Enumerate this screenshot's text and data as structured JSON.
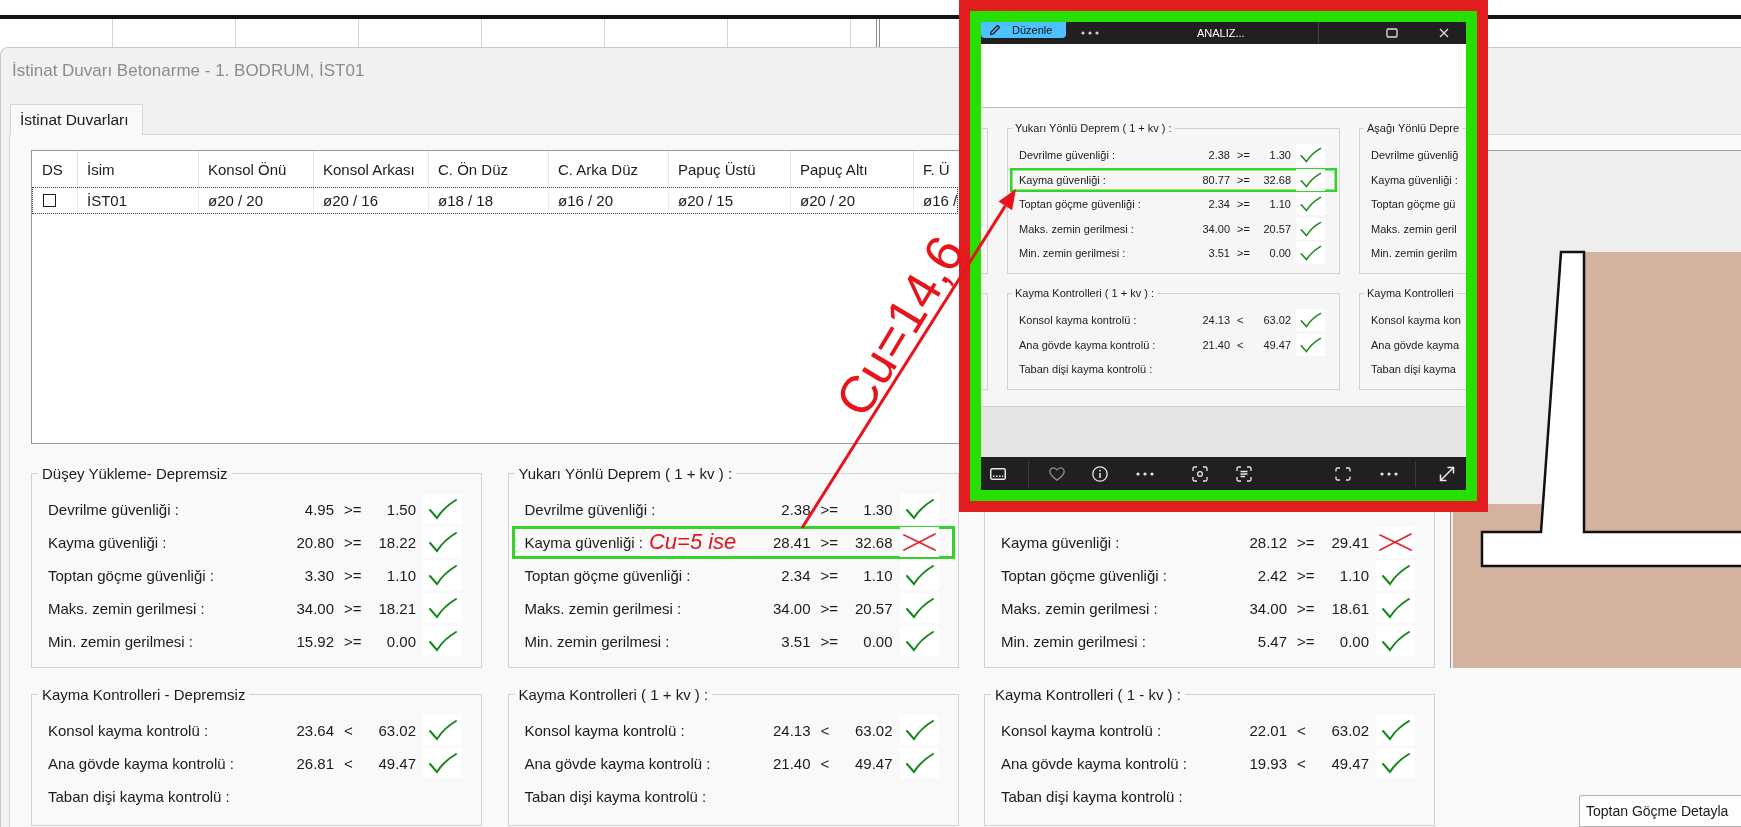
{
  "window": {
    "title": "İstinat Duvarı Betonarme - 1. BODRUM, İST01"
  },
  "tabs": [
    {
      "label": "İstinat Duvarları",
      "selected": true
    }
  ],
  "table": {
    "columns": [
      "DS",
      "İsim",
      "Konsol Önü",
      "Konsol Arkası",
      "C. Ön Düz",
      "C. Arka Düz",
      "Papuç Üstü",
      "Papuç Altı",
      "F. Ü"
    ],
    "rows": [
      {
        "checked": false,
        "cells": [
          "",
          "İST01",
          "ø20 / 20",
          "ø20 / 16",
          "ø18 / 18",
          "ø16 / 20",
          "ø20 / 15",
          "ø20 / 20",
          "ø16 /"
        ]
      }
    ]
  },
  "panels": [
    {
      "title": "Düşey Yükleme- Depremsiz",
      "rows": [
        {
          "label": "Devrilme güvenliği :",
          "value": "4.95",
          "operator": ">=",
          "limit": "1.50",
          "passed": true,
          "highlighted": false
        },
        {
          "label": "Kayma güvenliği :",
          "value": "20.80",
          "operator": ">=",
          "limit": "18.22",
          "passed": true,
          "highlighted": false
        },
        {
          "label": "Toptan göçme güvenliği :",
          "value": "3.30",
          "operator": ">=",
          "limit": "1.10",
          "passed": true,
          "highlighted": false
        },
        {
          "label": "Maks. zemin gerilmesi :",
          "value": "34.00",
          "operator": ">=",
          "limit": "18.21",
          "passed": true,
          "highlighted": false
        },
        {
          "label": "Min. zemin gerilmesi :",
          "value": "15.92",
          "operator": ">=",
          "limit": "0.00",
          "passed": true,
          "highlighted": false
        }
      ]
    },
    {
      "title": "Yukarı Yönlü Deprem ( 1 + kv ) :",
      "rows": [
        {
          "label": "Devrilme güvenliği :",
          "value": "2.38",
          "operator": ">=",
          "limit": "1.30",
          "passed": true,
          "highlighted": false
        },
        {
          "label": "Kayma güvenliği :",
          "note": "Cu=5 ise",
          "value": "28.41",
          "operator": ">=",
          "limit": "32.68",
          "passed": false,
          "highlighted": true
        },
        {
          "label": "Toptan göçme güvenliği :",
          "value": "2.34",
          "operator": ">=",
          "limit": "1.10",
          "passed": true,
          "highlighted": false
        },
        {
          "label": "Maks. zemin gerilmesi :",
          "value": "34.00",
          "operator": ">=",
          "limit": "20.57",
          "passed": true,
          "highlighted": false
        },
        {
          "label": "Min. zemin gerilmesi :",
          "value": "3.51",
          "operator": ">=",
          "limit": "0.00",
          "passed": true,
          "highlighted": false
        }
      ]
    },
    {
      "rows": [
        {
          "label": "Kayma güvenliği :",
          "value": "28.12",
          "operator": ">=",
          "limit": "29.41",
          "passed": false,
          "highlighted": false
        },
        {
          "label": "Toptan göçme güvenliği :",
          "value": "2.42",
          "operator": ">=",
          "limit": "1.10",
          "passed": true,
          "highlighted": false
        },
        {
          "label": "Maks. zemin gerilmesi :",
          "value": "34.00",
          "operator": ">=",
          "limit": "18.61",
          "passed": true,
          "highlighted": false
        },
        {
          "label": "Min. zemin gerilmesi :",
          "value": "5.47",
          "operator": ">=",
          "limit": "0.00",
          "passed": true,
          "highlighted": false
        }
      ]
    },
    {
      "title": "Kayma Kontrolleri - Depremsiz",
      "rows": [
        {
          "label": "Konsol kayma kontrolü :",
          "value": "23.64",
          "operator": "<",
          "limit": "63.02",
          "passed": true,
          "highlighted": false
        },
        {
          "label": "Ana gövde kayma kontrolü :",
          "value": "26.81",
          "operator": "<",
          "limit": "49.47",
          "passed": true,
          "highlighted": false
        },
        {
          "label": "Taban dişi kayma kontrolü :",
          "highlighted": false
        }
      ]
    },
    {
      "title": "Kayma Kontrolleri ( 1 + kv ) :",
      "rows": [
        {
          "label": "Konsol kayma kontrolü :",
          "value": "24.13",
          "operator": "<",
          "limit": "63.02",
          "passed": true,
          "highlighted": false
        },
        {
          "label": "Ana gövde kayma kontrolü :",
          "value": "21.40",
          "operator": "<",
          "limit": "49.47",
          "passed": true,
          "highlighted": false
        },
        {
          "label": "Taban dişi kayma kontrolü :",
          "highlighted": false
        }
      ]
    },
    {
      "title": "Kayma Kontrolleri ( 1 - kv ) :",
      "rows": [
        {
          "label": "Konsol kayma kontrolü :",
          "value": "22.01",
          "operator": "<",
          "limit": "63.02",
          "passed": true,
          "highlighted": false
        },
        {
          "label": "Ana gövde kayma kontrolü :",
          "value": "19.93",
          "operator": "<",
          "limit": "49.47",
          "passed": true,
          "highlighted": false
        },
        {
          "label": "Taban dişi kayma kontrolü :",
          "highlighted": false
        }
      ]
    }
  ],
  "detail_button": "Toptan Göçme Detayla",
  "photo_viewer": {
    "edit_button": "Düzenle",
    "file_name": "ANALIZ...",
    "panels": [
      {
        "title": "Yukarı Yönlü Deprem ( 1 + kv ) :",
        "rows": [
          {
            "label": "Devrilme güvenliği :",
            "value": "2.38",
            "operator": ">=",
            "limit": "1.30",
            "passed": true,
            "highlighted": false
          },
          {
            "label": "Kayma güvenliği :",
            "value": "80.77",
            "operator": ">=",
            "limit": "32.68",
            "passed": true,
            "highlighted": true
          },
          {
            "label": "Toptan göçme güvenliği :",
            "value": "2.34",
            "operator": ">=",
            "limit": "1.10",
            "passed": true,
            "highlighted": false
          },
          {
            "label": "Maks. zemin gerilmesi :",
            "value": "34.00",
            "operator": ">=",
            "limit": "20.57",
            "passed": true,
            "highlighted": false
          },
          {
            "label": "Min. zemin gerilmesi :",
            "value": "3.51",
            "operator": ">=",
            "limit": "0.00",
            "passed": true,
            "highlighted": false
          }
        ]
      },
      {
        "title": "Aşağı Yönlü Depre",
        "rows": [
          {
            "label": "Devrilme güvenliğ",
            "highlighted": false
          },
          {
            "label": "Kayma güvenliği :",
            "highlighted": false
          },
          {
            "label": "Toptan göçme gü",
            "highlighted": false
          },
          {
            "label": "Maks. zemin geril",
            "highlighted": false
          },
          {
            "label": "Min. zemin gerilm",
            "highlighted": false
          }
        ]
      },
      {
        "title": "Kayma Kontrolleri ( 1 + kv ) :",
        "rows": [
          {
            "label": "Konsol kayma kontrolü :",
            "value": "24.13",
            "operator": "<",
            "limit": "63.02",
            "passed": true,
            "highlighted": false
          },
          {
            "label": "Ana gövde kayma kontrolü :",
            "value": "21.40",
            "operator": "<",
            "limit": "49.47",
            "passed": true,
            "highlighted": false
          },
          {
            "label": "Taban dişi kayma kontrolü :",
            "highlighted": false
          }
        ]
      },
      {
        "title": "Kayma Kontrolleri",
        "rows": [
          {
            "label": "Konsol kayma kon",
            "highlighted": false
          },
          {
            "label": "Ana gövde kayma",
            "highlighted": false
          },
          {
            "label": "Taban dişi kayma",
            "highlighted": false
          }
        ]
      }
    ]
  },
  "annotation": {
    "label": "Cu=14,6"
  }
}
